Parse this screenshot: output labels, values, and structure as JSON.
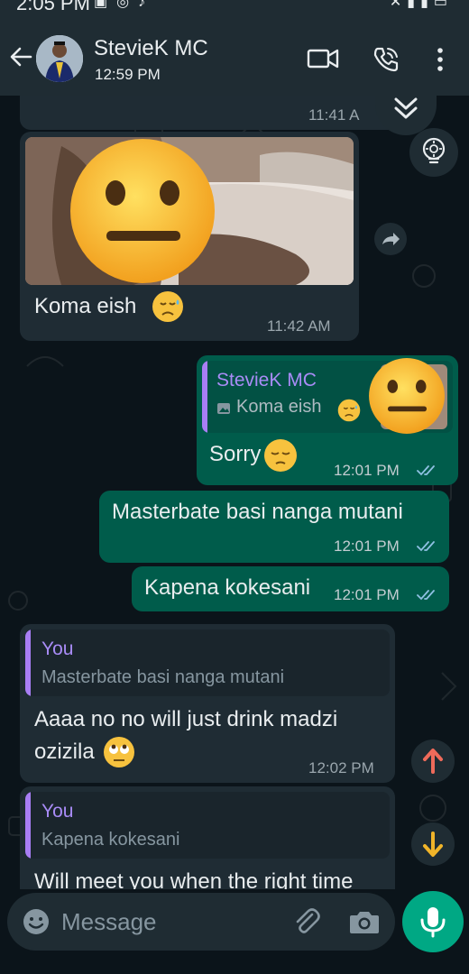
{
  "status_bar": {
    "time": "2:05 PM",
    "left_icons": [
      "gallery-icon",
      "messenger-icon",
      "tiktok-icon"
    ],
    "right_icons": [
      "mute-icon",
      "signal-icon",
      "signal-icon",
      "battery-icon"
    ]
  },
  "header": {
    "contact_name": "StevieK MC",
    "last_seen": "12:59 PM",
    "icons": [
      "back-arrow-icon",
      "video-call-icon",
      "voice-call-icon",
      "more-options-icon"
    ]
  },
  "messages": [
    {
      "direction": "incoming",
      "time": "11:41 A",
      "truncated": true
    },
    {
      "direction": "incoming",
      "type": "image",
      "caption": "Koma eish",
      "time": "11:42 AM",
      "sticker": "neutral-face-emoji"
    },
    {
      "direction": "outgoing",
      "quote_author": "StevieK MC",
      "quote_text": "Koma eish",
      "text": "Sorry",
      "time": "12:01 PM",
      "status": "read"
    },
    {
      "direction": "outgoing",
      "text": "Masterbate basi nanga mutani",
      "time": "12:01 PM",
      "status": "read"
    },
    {
      "direction": "outgoing",
      "text": "Kapena kokesani",
      "time": "12:01 PM",
      "status": "read"
    },
    {
      "direction": "incoming",
      "quote_author": "You",
      "quote_text": "Masterbate basi nanga mutani",
      "text_line1": "Aaaa no no will just drink madzi",
      "text_line2": "ozizila",
      "time": "12:02 PM"
    },
    {
      "direction": "incoming",
      "quote_author": "You",
      "quote_text": "Kapena kokesani",
      "text": "Will meet you when the right time"
    }
  ],
  "composer": {
    "placeholder": "Message",
    "icons": [
      "emoji-icon",
      "attach-icon",
      "camera-icon",
      "mic-icon"
    ]
  },
  "colors": {
    "incoming_bubble": "#1f2c34",
    "outgoing_bubble": "#005c4b",
    "quote_author": "#a98cf7",
    "accent": "#00a884",
    "up_arrow": "#ee6a5a",
    "down_arrow": "#f0b429"
  }
}
